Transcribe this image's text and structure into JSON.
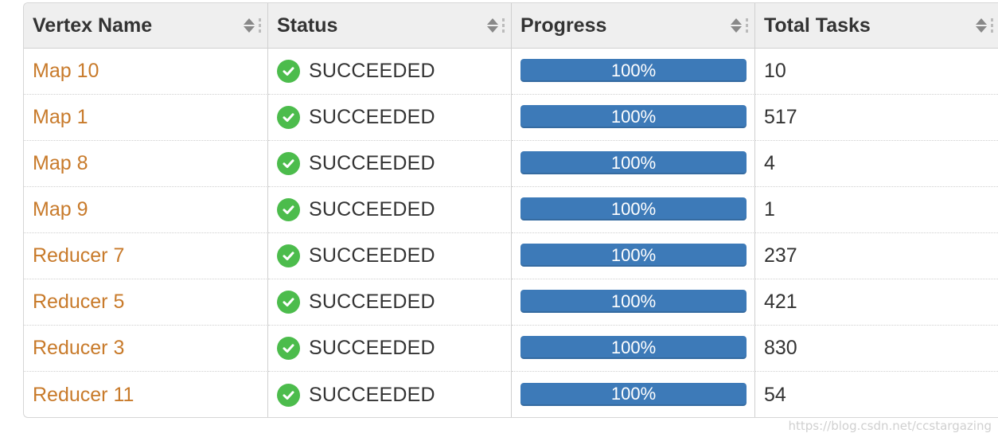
{
  "table": {
    "columns": [
      {
        "label": "Vertex Name"
      },
      {
        "label": "Status"
      },
      {
        "label": "Progress"
      },
      {
        "label": "Total Tasks"
      }
    ],
    "rows": [
      {
        "name": "Map 10",
        "status": "SUCCEEDED",
        "progress_label": "100%",
        "progress": 1.0,
        "total_tasks": "10"
      },
      {
        "name": "Map 1",
        "status": "SUCCEEDED",
        "progress_label": "100%",
        "progress": 1.0,
        "total_tasks": "517"
      },
      {
        "name": "Map 8",
        "status": "SUCCEEDED",
        "progress_label": "100%",
        "progress": 1.0,
        "total_tasks": "4"
      },
      {
        "name": "Map 9",
        "status": "SUCCEEDED",
        "progress_label": "100%",
        "progress": 1.0,
        "total_tasks": "1"
      },
      {
        "name": "Reducer 7",
        "status": "SUCCEEDED",
        "progress_label": "100%",
        "progress": 1.0,
        "total_tasks": "237"
      },
      {
        "name": "Reducer 5",
        "status": "SUCCEEDED",
        "progress_label": "100%",
        "progress": 1.0,
        "total_tasks": "421"
      },
      {
        "name": "Reducer 3",
        "status": "SUCCEEDED",
        "progress_label": "100%",
        "progress": 1.0,
        "total_tasks": "830"
      },
      {
        "name": "Reducer 11",
        "status": "SUCCEEDED",
        "progress_label": "100%",
        "progress": 1.0,
        "total_tasks": "54"
      }
    ]
  },
  "icons": {
    "status_icon": "check-circle-icon",
    "sort_icon": "sort-icon",
    "column_handle_icon": "drag-handle-icon"
  },
  "colors": {
    "link": "#c87a2a",
    "success": "#4cbc4c",
    "progress_fill": "#3d7ab8",
    "header_bg": "#efefef"
  },
  "watermark": "https://blog.csdn.net/ccstargazing"
}
